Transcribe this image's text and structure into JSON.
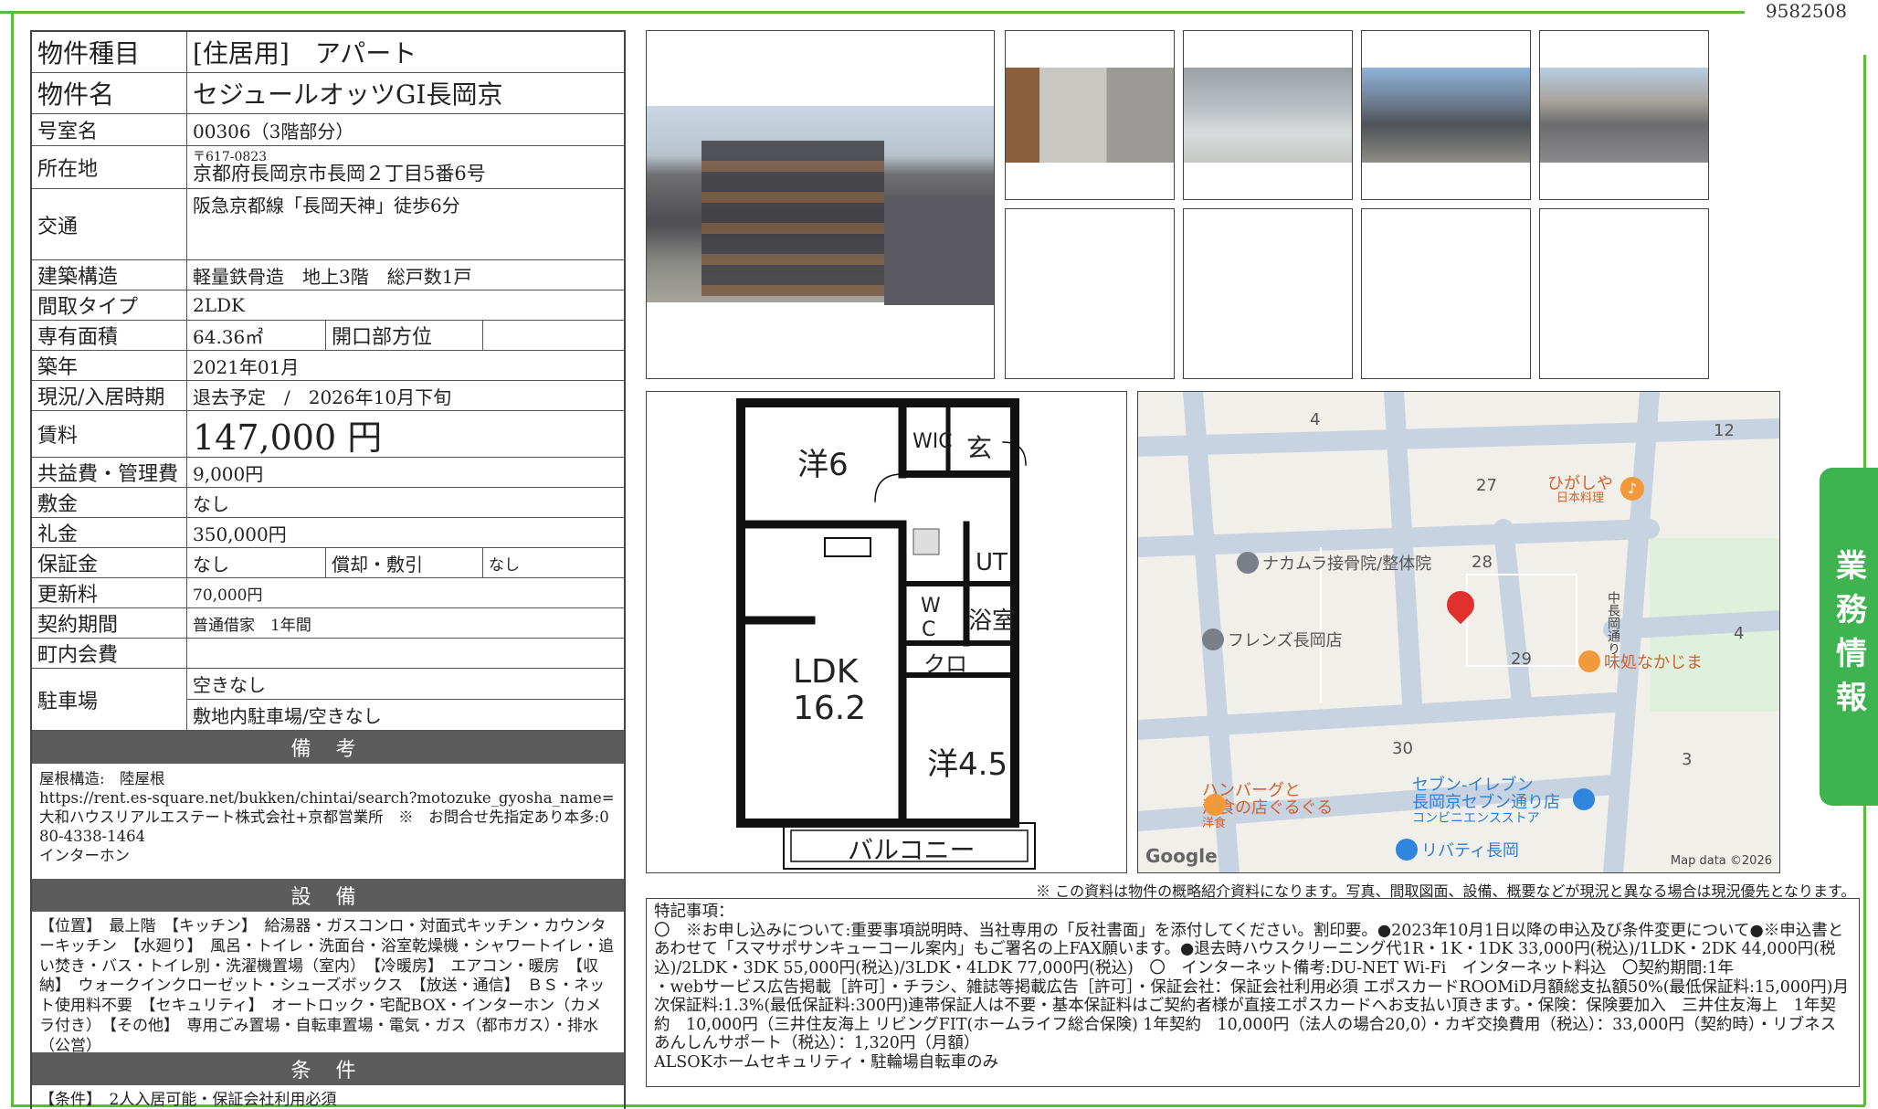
{
  "doc_id": "9582508",
  "spec": {
    "type_label": "物件種目",
    "type_value": "[住居用]　アパート",
    "name_label": "物件名",
    "name_value": "セジュールオッツGI長岡京",
    "room_label": "号室名",
    "room_value": "00306（3階部分）",
    "address_label": "所在地",
    "postal": "〒617-0823",
    "address_value": "京都府長岡京市長岡２丁目5番6号",
    "transport_label": "交通",
    "transport_value": "阪急京都線「長岡天神」徒歩6分",
    "structure_label": "建築構造",
    "structure_value": "軽量鉄骨造　地上3階　総戸数1戸",
    "layout_label": "間取タイプ",
    "layout_value": "2LDK",
    "area_label": "専有面積",
    "area_value": "64.36㎡",
    "facing_label": "開口部方位",
    "facing_value": "",
    "built_label": "築年",
    "built_value": "2021年01月",
    "status_label": "現況/入居時期",
    "status_value": "退去予定　/　2026年10月下旬",
    "rent_label": "賃料",
    "rent_value": "147,000 円",
    "fee_label": "共益費・管理費",
    "fee_value": "9,000円",
    "deposit_label": "敷金",
    "deposit_value": "なし",
    "keymoney_label": "礼金",
    "keymoney_value": "350,000円",
    "guarantee_label": "保証金",
    "guarantee_value": "なし",
    "amort_label": "償却・敷引",
    "amort_value": "なし",
    "renewal_label": "更新料",
    "renewal_value": "70,000円",
    "contract_label": "契約期間",
    "contract_value": "普通借家　1年間",
    "town_label": "町内会費",
    "town_value": "",
    "parking_label": "駐車場",
    "parking_value1": "空きなし",
    "parking_value2": "敷地内駐車場/空きなし"
  },
  "notes": {
    "heading": "備 考",
    "text": "屋根構造:　陸屋根\nhttps://rent.es-square.net/bukken/chintai/search?motozuke_gyosha_name=大和ハウスリアルエステート株式会社+京都営業所　※　お問合せ先指定あり本多:080-4338-1464\nインターホン"
  },
  "facilities": {
    "heading": "設 備",
    "text": "【位置】　最上階　【キッチン】　給湯器・ガスコンロ・対面式キッチン・カウンターキッチン　【水廻り】　風呂・トイレ・洗面台・浴室乾燥機・シャワートイレ・追い焚き・バス・トイレ別・洗濯機置場（室内）　【冷暖房】　エアコン・暖房　【収納】　ウォークインクローゼット・シューズボックス　【放送・通信】　ＢＳ・ネット使用料不要　【セキュリティ】　オートロック・宅配BOX・インターホン（カメラ付き）　【その他】　専用ごみ置場・自転車置場・電気・ガス（都市ガス）・排水（公営）"
  },
  "conditions": {
    "heading": "条 件",
    "text": "【条件】　2人入居可能・保証会社利用必須"
  },
  "floorplan": {
    "room1": "洋6",
    "wic": "WIC",
    "entry": "玄",
    "ut": "UT",
    "wc_w": "W",
    "wc_c": "C",
    "bath": "浴室",
    "ldk": "LDK",
    "ldk_size": "16.2",
    "closet": "クロ",
    "room2": "洋4.5",
    "balcony": "バルコニー"
  },
  "map": {
    "labels": [
      "4",
      "12",
      "27",
      "28",
      "29",
      "30",
      "3",
      "4"
    ],
    "higashiya": "ひがしや",
    "higashiya_sub": "日本料理",
    "nakamura": "ナカムラ接骨院/整体院",
    "friends": "フレンズ長岡店",
    "nakajima": "味処なかじま",
    "hamburg1": "ハンバーグと",
    "hamburg2": "洋食の店ぐるぐる",
    "hamburg3": "洋食",
    "seven1": "セブン-イレブン",
    "seven2": "長岡京セブン通り店",
    "seven3": "コンビニエンスストア",
    "liberty": "リバティ長岡",
    "road": "中長岡通り",
    "google": "Google",
    "mapdata": "Map data ©2026"
  },
  "side_tab": "業務情報",
  "disclaimer": "※ この資料は物件の概略紹介資料になります。写真、間取図面、設備、概要などが現況と異なる場合は現況優先となります。",
  "remarks": "特記事項：\n〇　※お申し込みについて:重要事項説明時、当社専用の「反社書面」を添付してください。割印要。●2023年10月1日以降の申込及び条件変更について●※申込書とあわせて「スマサポサンキューコール案内」もご署名の上FAX願います。●退去時ハウスクリーニング代1R・1K・1DK 33,000円(税込)/1LDK・2DK 44,000円(税込)/2LDK・3DK 55,000円(税込)/3LDK・4LDK 77,000円(税込)　〇　インターネット備考:DU-NET Wi-Fi　インターネット料込　〇契約期間:1年\n・webサービス広告掲載［許可］・チラシ、雑誌等掲載広告［許可］・保証会社：保証会社利用必須 エポスカードROOMiD月額総支払額50%(最低保証料:15,000円)月次保証料:1.3%(最低保証料:300円)連帯保証人は不要・基本保証料はご契約者様が直接エポスカードへお支払い頂きます。・保険：保険要加入　三井住友海上　1年契約　10,000円（三井住友海上 リビングFIT(ホームライフ総合保険) 1年契約　10,000円（法人の場合20,0）・カギ交換費用（税込）：33,000円（契約時）・リブネスあんしんサポート（税込）：1,320円（月額）\nALSOKホームセキュリティ・駐輪場自転車のみ"
}
